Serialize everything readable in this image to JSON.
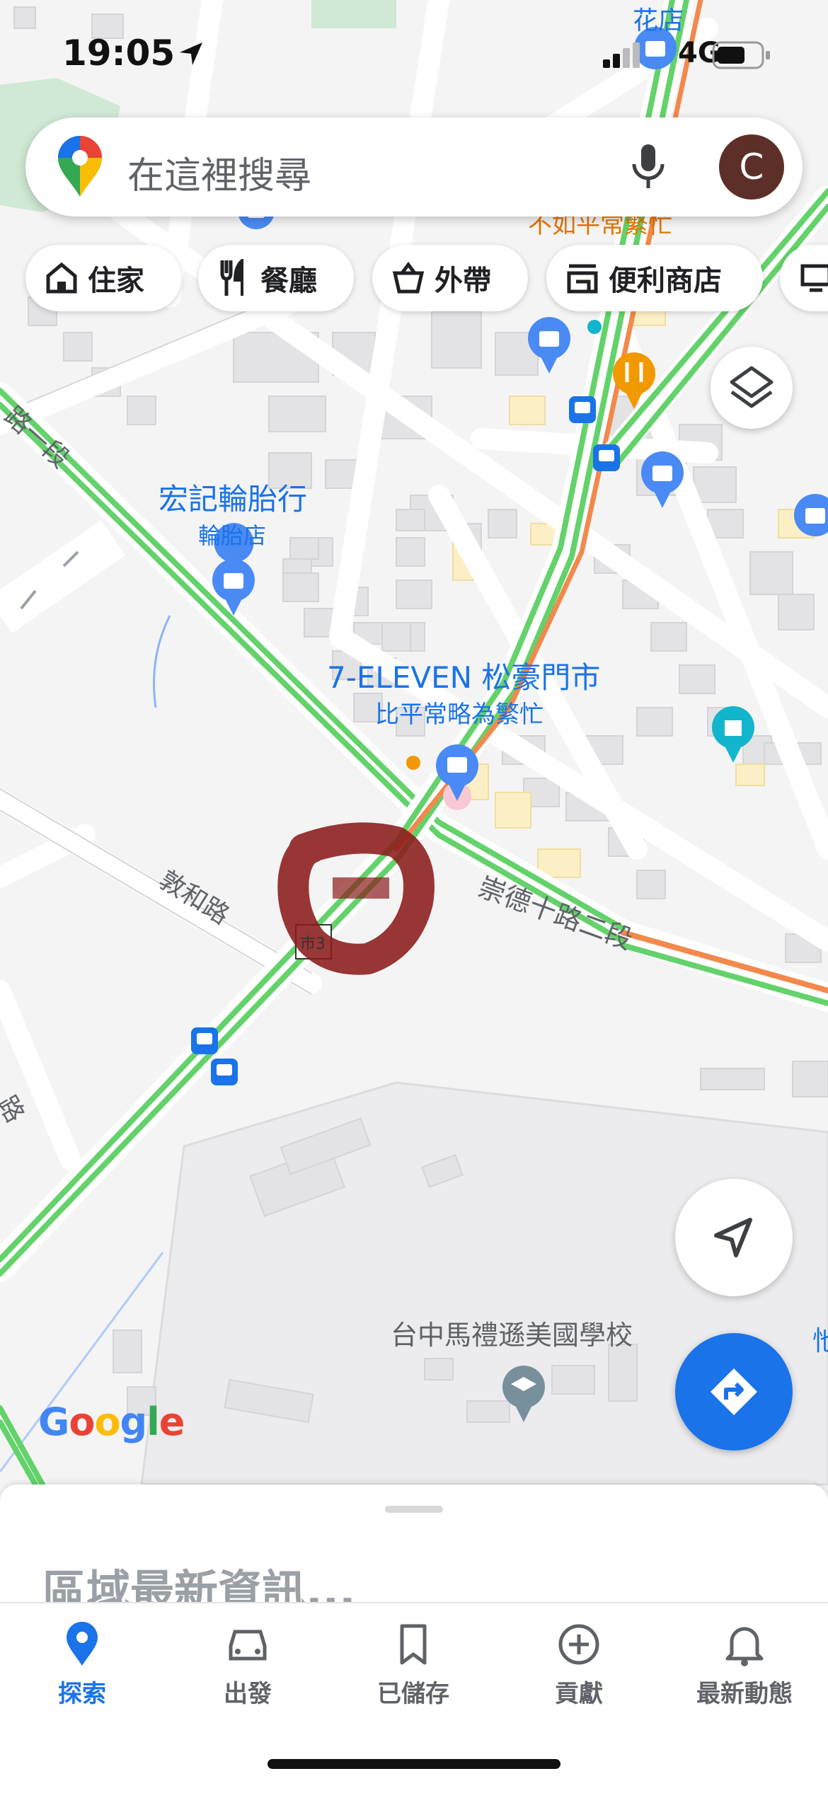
{
  "status": {
    "time": "19:05",
    "network": "4G"
  },
  "search": {
    "placeholder": "在這裡搜尋",
    "avatar_letter": "C"
  },
  "chips": [
    {
      "label": "住家",
      "icon": "home-icon"
    },
    {
      "label": "餐廳",
      "icon": "restaurant-icon"
    },
    {
      "label": "外帶",
      "icon": "takeout-icon"
    },
    {
      "label": "便利商店",
      "icon": "store-icon"
    }
  ],
  "map": {
    "labels": {
      "flower_shop": "花店",
      "busy_top": "不如平常繁忙",
      "tire_shop_name": "宏記輪胎行",
      "tire_shop_type": "輪胎店",
      "seven_eleven": "7-ELEVEN 松豪門市",
      "seven_busy": "比平常略為繁忙",
      "dunhe_road": "敦和路",
      "chongde_road": "崇德十路二段",
      "road_top_left": "路一段",
      "road_left": "路",
      "route_marker": "市3",
      "school": "台中馬禮遜美國學校",
      "right_edge": "忚"
    },
    "google_logo": "Google"
  },
  "sheet": {
    "title": "區域最新資訊..."
  },
  "nav": [
    {
      "label": "探索",
      "icon": "explore-pin-icon",
      "active": true
    },
    {
      "label": "出發",
      "icon": "car-icon",
      "active": false
    },
    {
      "label": "已儲存",
      "icon": "bookmark-icon",
      "active": false
    },
    {
      "label": "貢獻",
      "icon": "add-circle-icon",
      "active": false
    },
    {
      "label": "最新動態",
      "icon": "bell-icon",
      "active": false
    }
  ],
  "colors": {
    "accent": "#1a73e8",
    "traffic_green": "#63d26a",
    "traffic_orange": "#f2894c",
    "poi_blue": "#4a8af4",
    "annotation": "#8b1a1a"
  }
}
